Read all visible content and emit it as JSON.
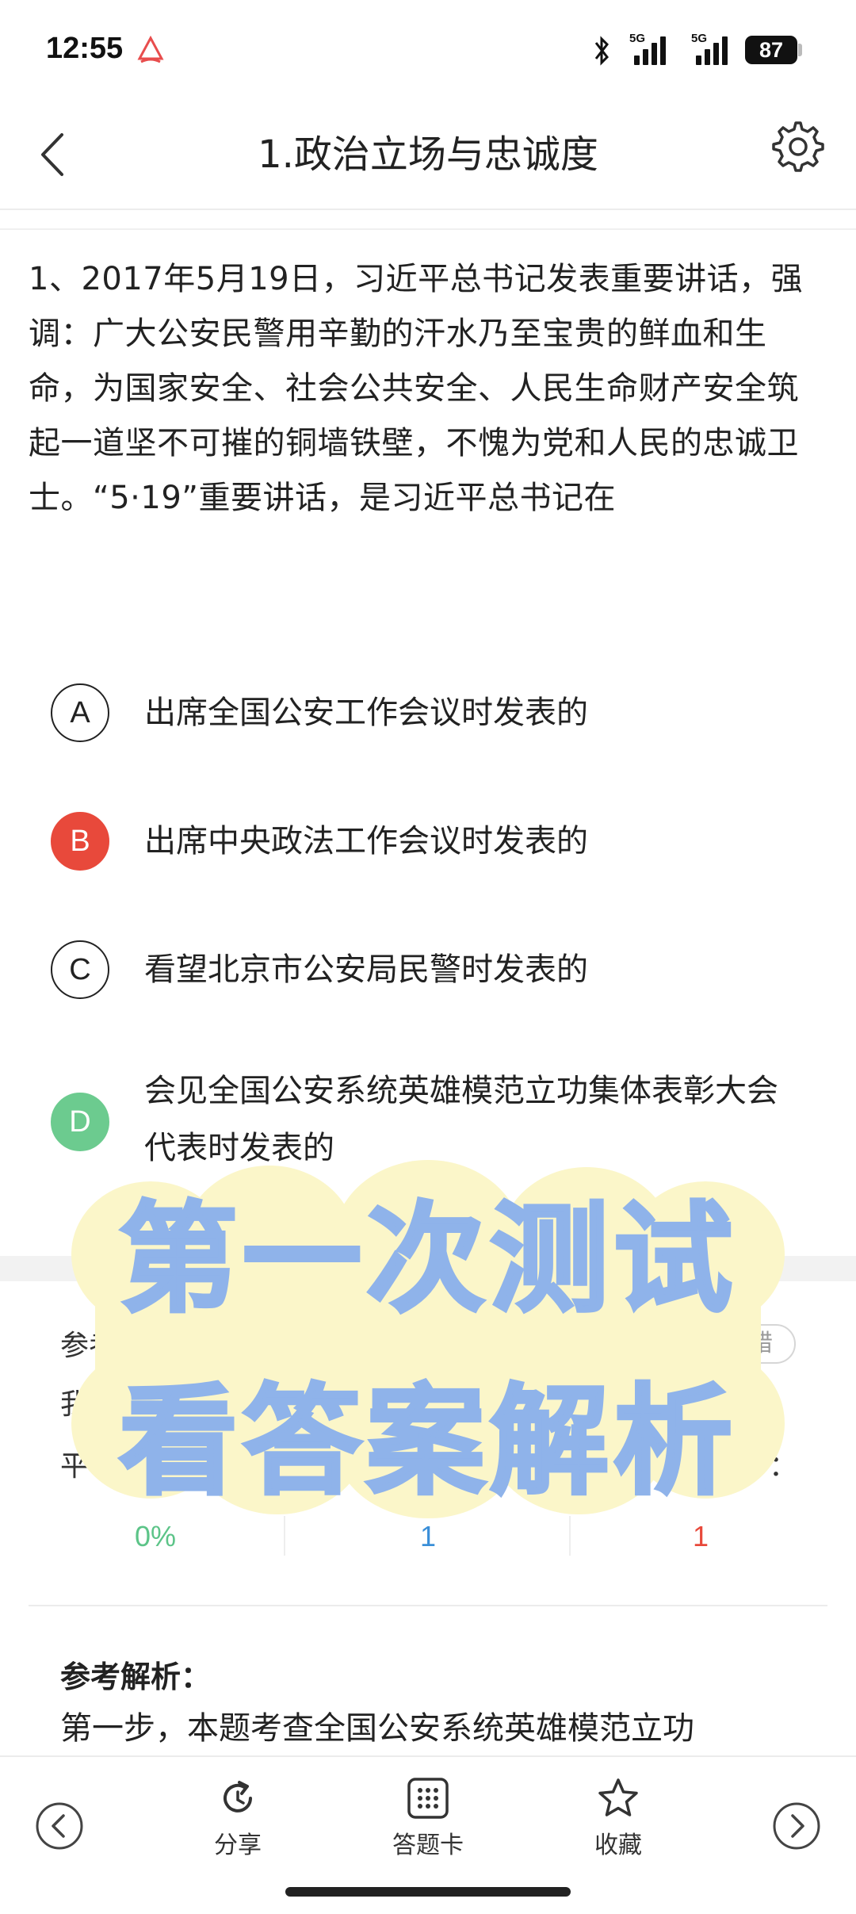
{
  "status_bar": {
    "time": "12:55",
    "sig1": "5G",
    "sig2": "5G",
    "battery": "87"
  },
  "header": {
    "title": "1.政治立场与忠诚度"
  },
  "question": {
    "text": "1、2017年5月19日，习近平总书记发表重要讲话，强调：广大公安民警用辛勤的汗水乃至宝贵的鲜血和生命，为国家安全、社会公共安全、人民生命财产安全筑起一道坚不可摧的铜墙铁壁，不愧为党和人民的忠诚卫士。“5·19”重要讲话，是习近平总书记在"
  },
  "options": [
    {
      "letter": "A",
      "text": "出席全国公安工作会议时发表的",
      "state": "normal"
    },
    {
      "letter": "B",
      "text": "出席中央政法工作会议时发表的",
      "state": "wrong"
    },
    {
      "letter": "C",
      "text": "看望北京市公安局民警时发表的",
      "state": "normal"
    },
    {
      "letter": "D",
      "text": "会见全国公安系统英雄模范立功集体表彰大会代表时发表的",
      "state": "right"
    }
  ],
  "answer": {
    "label": "参考答案：",
    "value": "D",
    "feedback": "反馈纠错",
    "mine_label_visible": "我",
    "stats_labels_visible": "平",
    "stats_right_fragment": "："
  },
  "stats": {
    "accuracy": "0%",
    "count_done": "1",
    "count_wrong": "1"
  },
  "analysis": {
    "title": "参考解析：",
    "text": "第一步，本题考查全国公安系统英雄模范立功"
  },
  "overlay": {
    "line1": "第一次测试",
    "line2": "看答案解析"
  },
  "toolbar": {
    "share": "分享",
    "answer_card": "答题卡",
    "favorite": "收藏"
  },
  "colors": {
    "wrong": "#e8493b",
    "right": "#6ccb8f",
    "stat_green": "#5cc488",
    "stat_blue": "#3a8fd8",
    "stat_red": "#e8493b",
    "overlay_text": "#8fb3ea",
    "overlay_bg": "#fbf6c9"
  }
}
